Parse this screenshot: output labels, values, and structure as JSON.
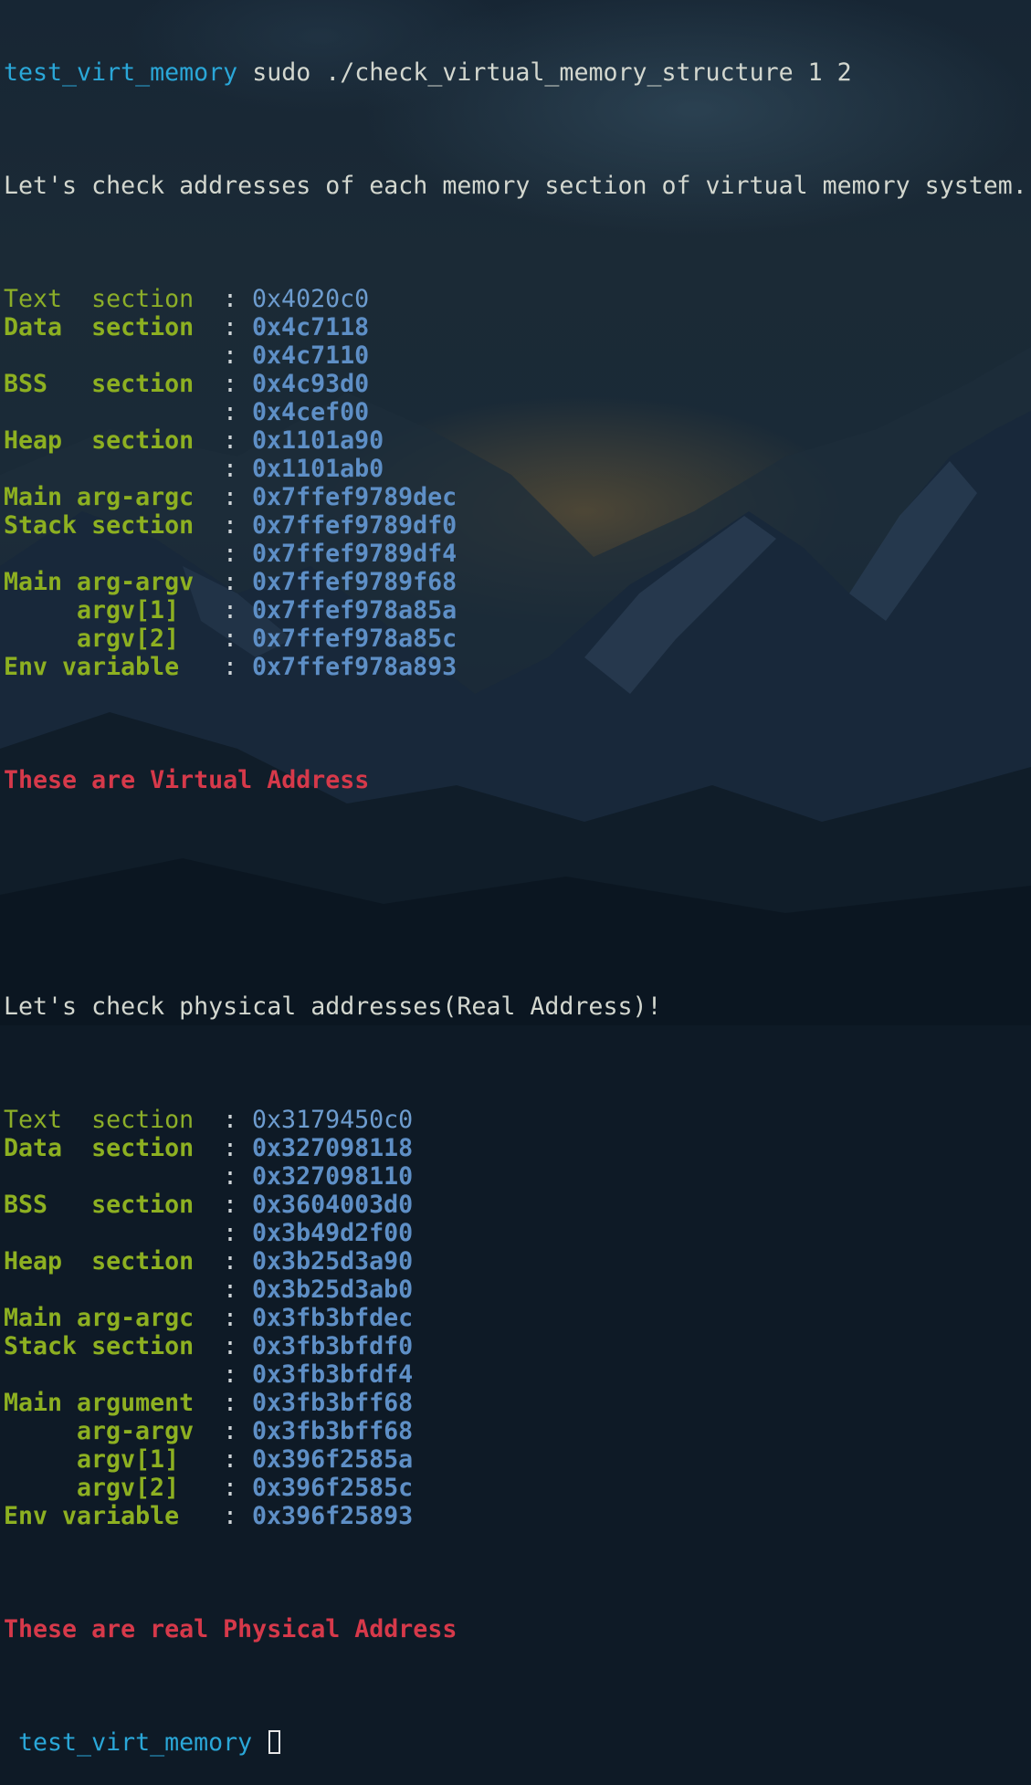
{
  "prompt": {
    "dir": "test_virt_memory",
    "command": "sudo ./check_virtual_memory_structure 1 2"
  },
  "virtual": {
    "intro": "Let's check addresses of each memory section of virtual memory system.",
    "rows": [
      {
        "label": "Text  section",
        "addr": "0x4020c0"
      },
      {
        "label": "Data  section",
        "addr": "0x4c7118"
      },
      {
        "label": "",
        "addr": "0x4c7110"
      },
      {
        "label": "BSS   section",
        "addr": "0x4c93d0"
      },
      {
        "label": "",
        "addr": "0x4cef00"
      },
      {
        "label": "Heap  section",
        "addr": "0x1101a90"
      },
      {
        "label": "",
        "addr": "0x1101ab0"
      },
      {
        "label": "Main arg-argc",
        "addr": "0x7ffef9789dec"
      },
      {
        "label": "Stack section",
        "addr": "0x7ffef9789df0"
      },
      {
        "label": "",
        "addr": "0x7ffef9789df4"
      },
      {
        "label": "Main arg-argv",
        "addr": "0x7ffef9789f68"
      },
      {
        "label": "argv[1]",
        "addr": "0x7ffef978a85a"
      },
      {
        "label": "argv[2]",
        "addr": "0x7ffef978a85c"
      },
      {
        "label": "Env variable",
        "addr": "0x7ffef978a893"
      }
    ],
    "footer": "These are Virtual Address"
  },
  "physical": {
    "intro": "Let's check physical addresses(Real Address)!",
    "rows": [
      {
        "label": "Text  section",
        "addr": "0x3179450c0"
      },
      {
        "label": "Data  section",
        "addr": "0x327098118"
      },
      {
        "label": "",
        "addr": "0x327098110"
      },
      {
        "label": "BSS   section",
        "addr": "0x3604003d0"
      },
      {
        "label": "",
        "addr": "0x3b49d2f00"
      },
      {
        "label": "Heap  section",
        "addr": "0x3b25d3a90"
      },
      {
        "label": "",
        "addr": "0x3b25d3ab0"
      },
      {
        "label": "Main arg-argc",
        "addr": "0x3fb3bfdec"
      },
      {
        "label": "Stack section",
        "addr": "0x3fb3bfdf0"
      },
      {
        "label": "",
        "addr": "0x3fb3bfdf4"
      },
      {
        "label": "Main argument",
        "addr": "0x3fb3bff68"
      },
      {
        "label": "arg-argv",
        "addr": "0x3fb3bff68"
      },
      {
        "label": "argv[1]",
        "addr": "0x396f2585a"
      },
      {
        "label": "argv[2]",
        "addr": "0x396f2585c"
      },
      {
        "label": "Env variable",
        "addr": "0x396f25893"
      }
    ],
    "footer": "These are real Physical Address"
  },
  "separator": ":",
  "final_prompt": {
    "dir": "test_virt_memory"
  },
  "colors": {
    "label": "#8db021",
    "address": "#5e8fc6",
    "alert": "#d6394a",
    "prompt": "#2aa7d8",
    "text": "#d3d7cf"
  }
}
